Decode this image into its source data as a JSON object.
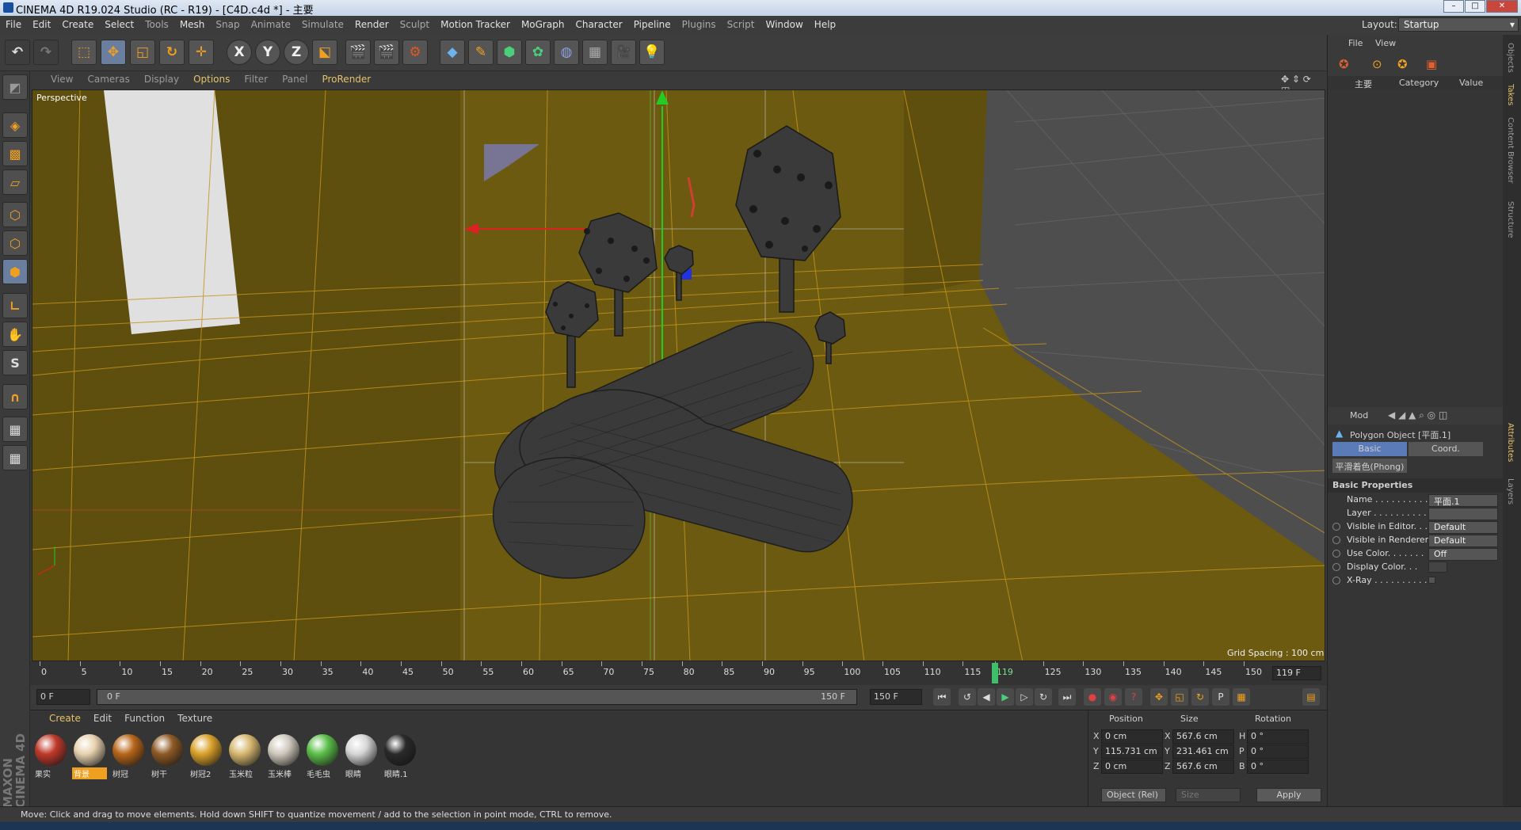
{
  "window": {
    "title": "CINEMA 4D R19.024 Studio (RC - R19) - [C4D.c4d *] - 主要"
  },
  "menu": [
    "File",
    "Edit",
    "Create",
    "Select",
    "Tools",
    "Mesh",
    "Snap",
    "Animate",
    "Simulate",
    "Render",
    "Sculpt",
    "Motion Tracker",
    "MoGraph",
    "Character",
    "Pipeline",
    "Plugins",
    "Script",
    "Window",
    "Help"
  ],
  "layout": {
    "label": "Layout:",
    "value": "Startup"
  },
  "toolbar": {
    "axis_x": "X",
    "axis_y": "Y",
    "axis_z": "Z"
  },
  "viewport_menu": [
    "View",
    "Cameras",
    "Display",
    "Options",
    "Filter",
    "Panel",
    "ProRender"
  ],
  "viewport": {
    "name": "Perspective",
    "grid_spacing": "Grid Spacing : 100 cm"
  },
  "timeline": {
    "ticks": [
      "0",
      "5",
      "10",
      "15",
      "20",
      "25",
      "30",
      "35",
      "40",
      "45",
      "50",
      "55",
      "60",
      "65",
      "70",
      "75",
      "80",
      "85",
      "90",
      "95",
      "100",
      "105",
      "110",
      "115",
      "119",
      "125",
      "130",
      "135",
      "140",
      "145",
      "150"
    ],
    "current_frame": 119,
    "frame_field": "119 F",
    "start_field": "0 F",
    "range_start": "0 F",
    "range_end": "150 F",
    "end_field": "150 F"
  },
  "materials": {
    "menu": [
      "Create",
      "Edit",
      "Function",
      "Texture"
    ],
    "items": [
      {
        "label": "果实",
        "color": "#c0392b"
      },
      {
        "label": "背景",
        "color": "#e8d2b0",
        "selected": true
      },
      {
        "label": "树冠",
        "color": "#b8661a"
      },
      {
        "label": "树干",
        "color": "#8e5a24"
      },
      {
        "label": "树冠2",
        "color": "#d9a12a"
      },
      {
        "label": "玉米粒",
        "color": "#d7b870"
      },
      {
        "label": "玉米棒",
        "color": "#cfc9bd"
      },
      {
        "label": "毛毛虫",
        "color": "#5cbf4a"
      },
      {
        "label": "眼睛",
        "color": "#d6d6d6"
      },
      {
        "label": "眼睛.1",
        "color": "#2a2a2a"
      }
    ]
  },
  "coordinates": {
    "headers": {
      "position": "Position",
      "size": "Size",
      "rotation": "Rotation"
    },
    "rows": [
      {
        "axis": "X",
        "pos": "0 cm",
        "size_axis": "X",
        "size": "567.6 cm",
        "rot_axis": "H",
        "rot": "0 °"
      },
      {
        "axis": "Y",
        "pos": "115.731 cm",
        "size_axis": "Y",
        "size": "231.461 cm",
        "rot_axis": "P",
        "rot": "0 °"
      },
      {
        "axis": "Z",
        "pos": "0 cm",
        "size_axis": "Z",
        "size": "567.6 cm",
        "rot_axis": "B",
        "rot": "0 °"
      }
    ],
    "mode": "Object (Rel)",
    "size_mode": "Size",
    "apply": "Apply"
  },
  "status": "Move: Click and drag to move elements. Hold down SHIFT to quantize movement / add to the selection in point mode, CTRL to remove.",
  "objects_panel": {
    "menu": [
      "File",
      "View"
    ],
    "item": "主要",
    "col_category": "Category",
    "col_value": "Value"
  },
  "attributes": {
    "mode": "Mod",
    "object": "Polygon Object [平面.1]",
    "tabs": [
      "Basic",
      "Coord."
    ],
    "phong": "平滑着色(Phong)",
    "section": "Basic Properties",
    "props": [
      {
        "label": "Name . . . . . . . . . . .",
        "value": "平面.1"
      },
      {
        "label": "Layer . . . . . . . . . . .",
        "value": ""
      },
      {
        "label": "Visible in Editor. . .",
        "value": "Default"
      },
      {
        "label": "Visible in Renderer",
        "value": "Default"
      },
      {
        "label": "Use Color. . . . . . .",
        "value": "Off"
      },
      {
        "label": "Display Color. . .",
        "value": ""
      },
      {
        "label": "X-Ray . . . . . . . . . .",
        "value": ""
      }
    ]
  },
  "side_tabs": [
    "Objects",
    "Takes",
    "Content Browser",
    "Structure",
    "Attributes",
    "Layers"
  ],
  "brand": "MAXON CINEMA 4D"
}
